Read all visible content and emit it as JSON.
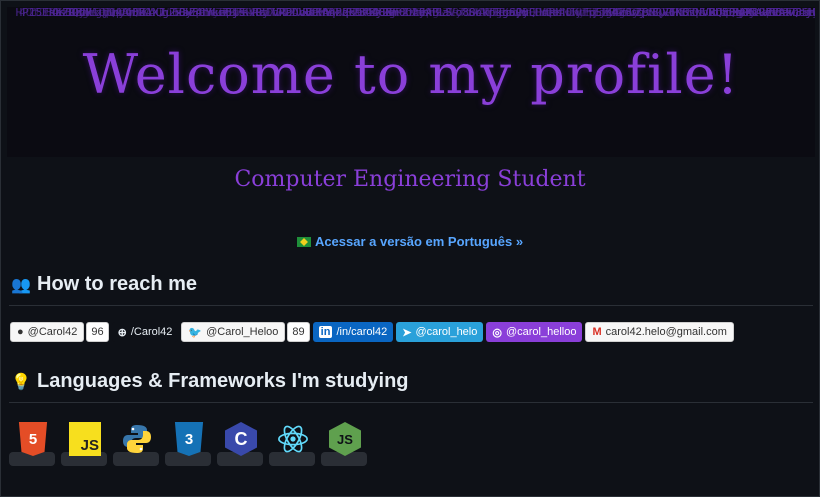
{
  "banner": {
    "title": "Welcome to my profile!",
    "matrix_color": "#5b2bb0",
    "title_color": "#8a3fd9"
  },
  "subtitle": "Computer Engineering Student",
  "portuguese_link": "Acessar a versão em Português »",
  "reach": {
    "heading": "How to reach me",
    "icon": "people-icon",
    "badges": [
      {
        "name": "github",
        "label": "@Carol42",
        "count": "96",
        "icon": "github-icon"
      },
      {
        "name": "dev",
        "label": "/Carol42",
        "icon": "dev-icon"
      },
      {
        "name": "twitter",
        "label": "@Carol_Heloo",
        "count": "89",
        "icon": "twitter-icon"
      },
      {
        "name": "linkedin",
        "label": "/in/carol42",
        "icon": "linkedin-icon"
      },
      {
        "name": "telegram",
        "label": "@carol_helo",
        "icon": "telegram-icon"
      },
      {
        "name": "instagram",
        "label": "@carol_helloo",
        "icon": "instagram-icon"
      },
      {
        "name": "gmail",
        "label": "carol42.helo@gmail.com",
        "icon": "gmail-icon"
      }
    ]
  },
  "languages": {
    "heading": "Languages & Frameworks I'm studying",
    "icon": "lightbulb-icon",
    "items": [
      {
        "name": "html5",
        "text": "5",
        "color": "#e44d26",
        "icon": "html5-icon"
      },
      {
        "name": "javascript",
        "text": "JS",
        "color": "#f7df1e",
        "icon": "javascript-icon"
      },
      {
        "name": "python",
        "text": "",
        "color": "#3776ab",
        "icon": "python-icon"
      },
      {
        "name": "css3",
        "text": "3",
        "color": "#1572b6",
        "icon": "css3-icon"
      },
      {
        "name": "c",
        "text": "C",
        "color": "#283593",
        "icon": "c-icon"
      },
      {
        "name": "react",
        "text": "",
        "color": "#61dafb",
        "icon": "react-icon"
      },
      {
        "name": "nodejs",
        "text": "JS",
        "color": "#5fa04e",
        "icon": "nodejs-icon"
      }
    ]
  }
}
